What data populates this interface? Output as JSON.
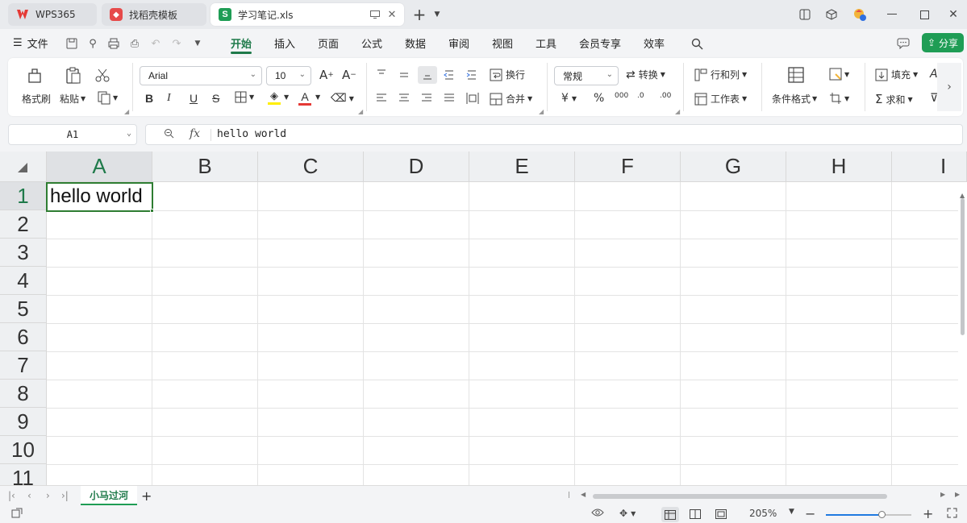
{
  "titlebar": {
    "tabs": [
      {
        "label": "WPS365",
        "icon": "wps-logo-icon"
      },
      {
        "label": "找稻壳模板",
        "icon": "docer-logo-icon"
      },
      {
        "label": "学习笔记.xls",
        "icon": "spreadsheet-icon",
        "icon_text": "S"
      }
    ],
    "new_tab": "+",
    "window_controls": [
      "minimize",
      "maximize",
      "close"
    ]
  },
  "menubar": {
    "file_label": "文件",
    "items": [
      "开始",
      "插入",
      "页面",
      "公式",
      "数据",
      "审阅",
      "视图",
      "工具",
      "会员专享",
      "效率"
    ],
    "active": "开始",
    "share_label": "分享"
  },
  "ribbon": {
    "format_painter": "格式刷",
    "paste": "粘贴",
    "font_name": "Arial",
    "font_size": "10",
    "bold": "B",
    "italic": "I",
    "underline": "U",
    "strike": "S",
    "wrap_label": "换行",
    "merge_label": "合并",
    "number_format": "常规",
    "convert_label": "转换",
    "rowcol_label": "行和列",
    "worksheet_label": "工作表",
    "cond_format_label": "条件格式",
    "fill_label": "填充",
    "sum_label": "求和",
    "currency": "¥",
    "percent": "%",
    "thousands": "000",
    "dec_increase": ".0",
    "dec_decrease": ".00",
    "font_grow": "A",
    "font_shrink": "A",
    "font_color_letter": "A"
  },
  "formula": {
    "cell_ref": "A1",
    "fx_label": "fx",
    "content": "hello world"
  },
  "grid": {
    "columns": [
      "A",
      "B",
      "C",
      "D",
      "E",
      "F",
      "G",
      "H",
      "I"
    ],
    "rows": [
      "1",
      "2",
      "3",
      "4",
      "5",
      "6",
      "7",
      "8",
      "9",
      "10",
      "11"
    ],
    "selected_cell": "A1",
    "cells": {
      "A1": "hello world"
    }
  },
  "sheets": {
    "tabs": [
      "小马过河"
    ],
    "active": "小马过河",
    "add_label": "+"
  },
  "status": {
    "zoom": "205%",
    "zoom_fraction": 0.65,
    "zoom_minus": "−",
    "zoom_plus": "+"
  },
  "colors": {
    "accent": "#1f9d55",
    "accent_dark": "#1f7a4a",
    "selection_border": "#2e7d32"
  }
}
